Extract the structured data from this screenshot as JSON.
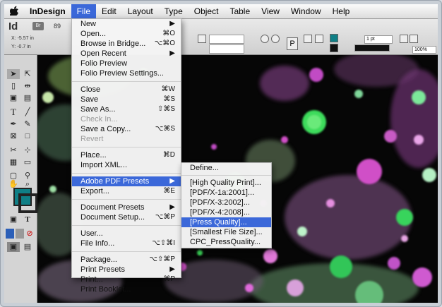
{
  "menubar": {
    "apple": "",
    "items": [
      "InDesign",
      "File",
      "Edit",
      "Layout",
      "Type",
      "Object",
      "Table",
      "View",
      "Window",
      "Help"
    ],
    "active": "File"
  },
  "control": {
    "logo": "Id",
    "bridge": "Br",
    "zoom": "89",
    "x_label": "X:",
    "x_value": "-5.57 in",
    "y_label": "Y:",
    "y_value": "-0.7 in",
    "stroke_weight": "1 pt",
    "percent": "100%"
  },
  "file_menu": [
    {
      "label": "New",
      "shortcut": "▶",
      "type": "item"
    },
    {
      "label": "Open...",
      "shortcut": "⌘O",
      "type": "item"
    },
    {
      "label": "Browse in Bridge...",
      "shortcut": "⌥⌘O",
      "type": "item"
    },
    {
      "label": "Open Recent",
      "shortcut": "▶",
      "type": "item"
    },
    {
      "label": "Folio Preview",
      "shortcut": "",
      "type": "item"
    },
    {
      "label": "Folio Preview Settings...",
      "shortcut": "",
      "type": "item"
    },
    {
      "type": "sep"
    },
    {
      "label": "Close",
      "shortcut": "⌘W",
      "type": "item"
    },
    {
      "label": "Save",
      "shortcut": "⌘S",
      "type": "item"
    },
    {
      "label": "Save As...",
      "shortcut": "⇧⌘S",
      "type": "item"
    },
    {
      "label": "Check In...",
      "shortcut": "",
      "type": "disabled"
    },
    {
      "label": "Save a Copy...",
      "shortcut": "⌥⌘S",
      "type": "item"
    },
    {
      "label": "Revert",
      "shortcut": "",
      "type": "disabled"
    },
    {
      "type": "sep"
    },
    {
      "label": "Place...",
      "shortcut": "⌘D",
      "type": "item"
    },
    {
      "label": "Import XML...",
      "shortcut": "",
      "type": "item"
    },
    {
      "type": "sep"
    },
    {
      "label": "Adobe PDF Presets",
      "shortcut": "▶",
      "type": "highlight"
    },
    {
      "label": "Export...",
      "shortcut": "⌘E",
      "type": "item"
    },
    {
      "type": "sep"
    },
    {
      "label": "Document Presets",
      "shortcut": "▶",
      "type": "item"
    },
    {
      "label": "Document Setup...",
      "shortcut": "⌥⌘P",
      "type": "item"
    },
    {
      "type": "sep"
    },
    {
      "label": "User...",
      "shortcut": "",
      "type": "item"
    },
    {
      "label": "File Info...",
      "shortcut": "⌥⇧⌘I",
      "type": "item"
    },
    {
      "type": "sep"
    },
    {
      "label": "Package...",
      "shortcut": "⌥⇧⌘P",
      "type": "item"
    },
    {
      "label": "Print Presets",
      "shortcut": "▶",
      "type": "item"
    },
    {
      "label": "Print...",
      "shortcut": "⌘P",
      "type": "item"
    },
    {
      "label": "Print Booklet...",
      "shortcut": "",
      "type": "item"
    }
  ],
  "pdf_submenu": [
    {
      "label": "Define...",
      "type": "item"
    },
    {
      "type": "sep"
    },
    {
      "label": "[High Quality Print]...",
      "type": "item"
    },
    {
      "label": "[PDF/X-1a:2001]...",
      "type": "item"
    },
    {
      "label": "[PDF/X-3:2002]...",
      "type": "item"
    },
    {
      "label": "[PDF/X-4:2008]...",
      "type": "item"
    },
    {
      "label": "[Press Quality]...",
      "type": "highlight"
    },
    {
      "label": "[Smallest File Size]...",
      "type": "item"
    },
    {
      "label": "CPC_PressQuality...",
      "type": "item"
    }
  ],
  "colors": {
    "menu_highlight": "#3b68d9",
    "fill_swatch": "#0f7f86"
  }
}
